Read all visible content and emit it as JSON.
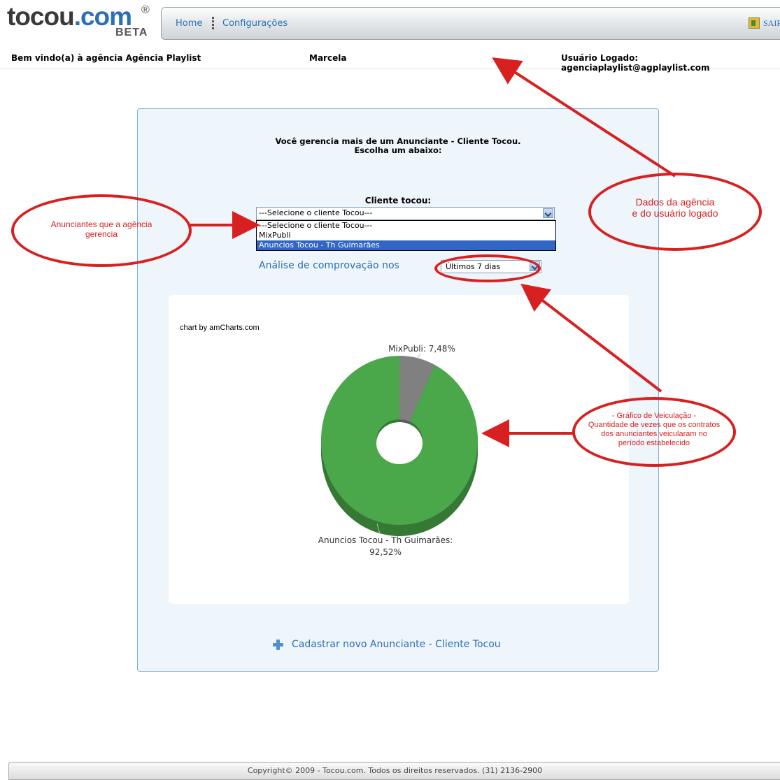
{
  "header": {
    "logo_text_dark": "tocou",
    "logo_text_blue": ".com",
    "logo_reg": "®",
    "logo_beta": "BETA",
    "nav": {
      "home": "Home",
      "settings": "Configurações",
      "exit": "SAIR"
    }
  },
  "user_bar": {
    "welcome": "Bem vindo(a) à agência Agência Playlist",
    "user_name": "Marcela",
    "logged_user": "Usuário Logado: agenciaplaylist@agplaylist.com"
  },
  "panel": {
    "title_line1": "Você gerencia mais de um Anunciante - Cliente Tocou.",
    "title_line2": "Escolha um abaixo:",
    "client_label": "Cliente tocou:",
    "client_select_value": "---Selecione o cliente Tocou---",
    "client_options": [
      "---Selecione o cliente Tocou---",
      "MixPubli",
      "Anuncios Tocou - Th Guimarães"
    ],
    "analysis_label": "Análise de comprovação nos",
    "period_value": "Últimos 7 dias",
    "chart_credit": "chart by amCharts.com",
    "add_client": "Cadastrar novo Anunciante - Cliente Tocou"
  },
  "chart_data": {
    "type": "pie",
    "variant": "donut-3d",
    "slices": [
      {
        "label": "MixPubli",
        "value": 7.48,
        "color": "#808080",
        "display": "MixPubli: 7,48%"
      },
      {
        "label": "Anuncios Tocou - Th Guimarães",
        "value": 92.52,
        "color": "#4aa84a",
        "display_line1": "Anuncios Tocou - Th Guimarães:",
        "display_line2": "92,52%"
      }
    ]
  },
  "annotations": {
    "agencies_advertisers_line1": "Anunciantes que a agência",
    "agencies_advertisers_line2": "gerencia",
    "agency_data_line1": "Dados da agência",
    "agency_data_line2": "e do usuário logado",
    "chart_note_line1": "- Gráfico de Veiculação -",
    "chart_note_line2": "Quantidade de vezes que os contratos",
    "chart_note_line3": "dos anunciantes veicularam no",
    "chart_note_line4": "período estabelecido",
    "color": "#d92020"
  },
  "footer": {
    "copyright": "Copyright© 2009 - Tocou.com. Todos os direitos reservados. (31) 2136-2900"
  }
}
